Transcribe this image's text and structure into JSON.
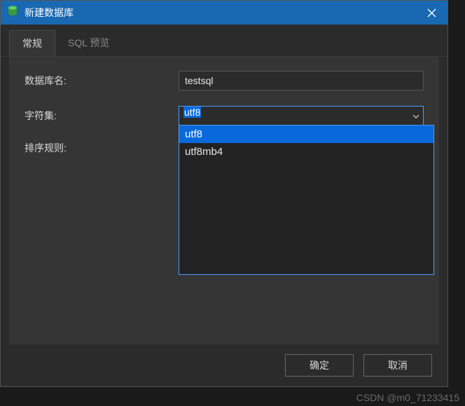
{
  "title": "新建数据库",
  "tabs": {
    "general": "常规",
    "sql_preview": "SQL 预览"
  },
  "form": {
    "db_name_label": "数据库名:",
    "db_name_value": "testsql",
    "charset_label": "字符集:",
    "charset_value": "utf8",
    "collation_label": "排序规则:"
  },
  "charset_options": {
    "opt0": "utf8",
    "opt1": "utf8mb4"
  },
  "buttons": {
    "ok": "确定",
    "cancel": "取消"
  },
  "watermark": "CSDN @m0_71233415"
}
